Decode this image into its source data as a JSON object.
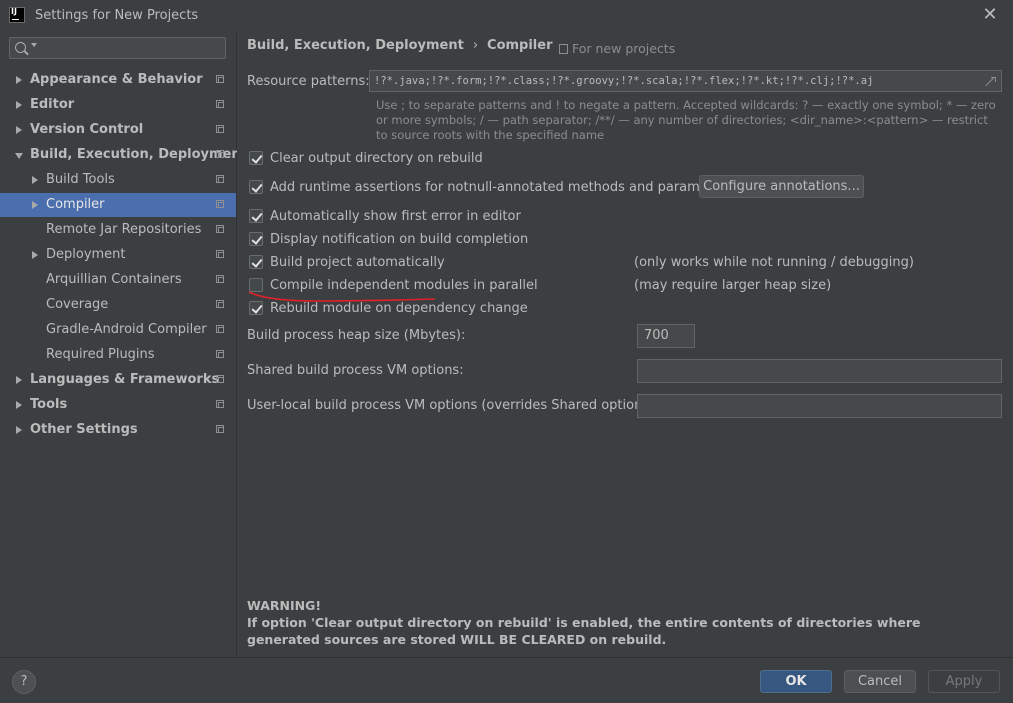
{
  "window": {
    "title": "Settings for New Projects",
    "close_glyph": "✕"
  },
  "sidebar": {
    "items": [
      {
        "label": "Appearance & Behavior",
        "level": 0,
        "expander": "collapsed",
        "bold": true,
        "selected": false
      },
      {
        "label": "Editor",
        "level": 0,
        "expander": "collapsed",
        "bold": true,
        "selected": false
      },
      {
        "label": "Version Control",
        "level": 0,
        "expander": "collapsed",
        "bold": true,
        "selected": false
      },
      {
        "label": "Build, Execution, Deployment",
        "level": 0,
        "expander": "expanded",
        "bold": true,
        "selected": false
      },
      {
        "label": "Build Tools",
        "level": 1,
        "expander": "collapsed",
        "bold": false,
        "selected": false
      },
      {
        "label": "Compiler",
        "level": 1,
        "expander": "collapsed",
        "bold": false,
        "selected": true
      },
      {
        "label": "Remote Jar Repositories",
        "level": 1,
        "expander": "none",
        "bold": false,
        "selected": false
      },
      {
        "label": "Deployment",
        "level": 1,
        "expander": "collapsed",
        "bold": false,
        "selected": false
      },
      {
        "label": "Arquillian Containers",
        "level": 1,
        "expander": "none",
        "bold": false,
        "selected": false
      },
      {
        "label": "Coverage",
        "level": 1,
        "expander": "none",
        "bold": false,
        "selected": false
      },
      {
        "label": "Gradle-Android Compiler",
        "level": 1,
        "expander": "none",
        "bold": false,
        "selected": false
      },
      {
        "label": "Required Plugins",
        "level": 1,
        "expander": "none",
        "bold": false,
        "selected": false
      },
      {
        "label": "Languages & Frameworks",
        "level": 0,
        "expander": "collapsed",
        "bold": true,
        "selected": false
      },
      {
        "label": "Tools",
        "level": 0,
        "expander": "collapsed",
        "bold": true,
        "selected": false
      },
      {
        "label": "Other Settings",
        "level": 0,
        "expander": "collapsed",
        "bold": true,
        "selected": false
      }
    ]
  },
  "breadcrumb": {
    "parent": "Build, Execution, Deployment",
    "separator": "›",
    "current": "Compiler",
    "scope": "For new projects"
  },
  "resource_patterns": {
    "label": "Resource patterns:",
    "value": "!?*.java;!?*.form;!?*.class;!?*.groovy;!?*.scala;!?*.flex;!?*.kt;!?*.clj;!?*.aj",
    "hint": "Use ; to separate patterns and ! to negate a pattern. Accepted wildcards: ? — exactly one symbol; * — zero or more symbols; / — path separator; /**/ — any number of directories; <dir_name>:<pattern> — restrict to source roots with the specified name"
  },
  "options": [
    {
      "label": "Clear output directory on rebuild",
      "checked": true
    },
    {
      "label": "Add runtime assertions for notnull-annotated methods and parameters",
      "checked": true
    },
    {
      "label": "Automatically show first error in editor",
      "checked": true
    },
    {
      "label": "Display notification on build completion",
      "checked": true
    },
    {
      "label": "Build project automatically",
      "checked": true,
      "note": "(only works while not running / debugging)"
    },
    {
      "label": "Compile independent modules in parallel",
      "checked": false,
      "note": "(may require larger heap size)"
    },
    {
      "label": "Rebuild module on dependency change",
      "checked": true
    }
  ],
  "configure_annotations_label": "Configure annotations...",
  "heap": {
    "label": "Build process heap size (Mbytes):",
    "value": "700"
  },
  "shared_vm": {
    "label": "Shared build process VM options:",
    "value": ""
  },
  "user_vm": {
    "label": "User-local build process VM options (overrides Shared options):",
    "value": ""
  },
  "warning": {
    "title": "WARNING!",
    "text": "If option 'Clear output directory on rebuild' is enabled, the entire contents of directories where generated sources are stored WILL BE CLEARED on rebuild."
  },
  "buttons": {
    "help": "?",
    "ok": "OK",
    "cancel": "Cancel",
    "apply": "Apply"
  },
  "colors": {
    "accent_selection": "#4b6eaf",
    "primary_button": "#365880",
    "annotation_red": "#e0202a"
  }
}
